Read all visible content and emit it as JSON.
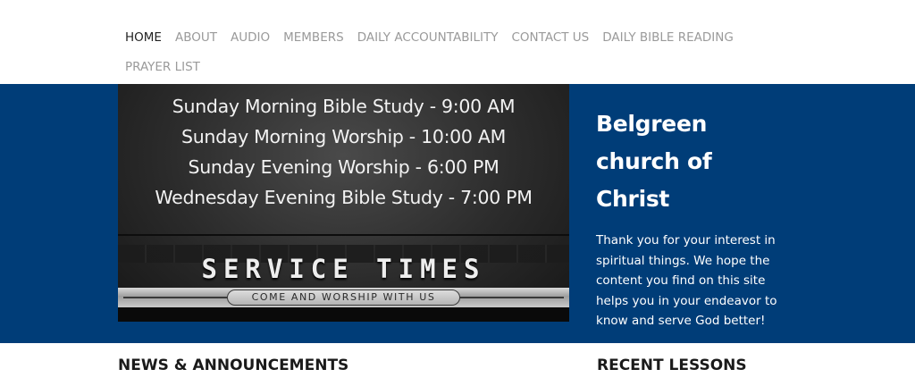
{
  "nav": {
    "items": [
      "HOME",
      "ABOUT",
      "AUDIO",
      "MEMBERS",
      "DAILY ACCOUNTABILITY",
      "CONTACT US",
      "DAILY BIBLE READING",
      "PRAYER LIST"
    ],
    "active": "HOME"
  },
  "banner": {
    "schedule": [
      "Sunday Morning Bible Study -  9:00 AM",
      "Sunday Morning Worship -  10:00 AM",
      "Sunday Evening Worship - 6:00 PM",
      "Wednesday Evening Bible Study - 7:00 PM"
    ],
    "headline": "SERVICE TIMES",
    "tagline": "COME AND WORSHIP WITH US"
  },
  "hero": {
    "title_lines": [
      "Belgreen",
      "church of",
      "Christ"
    ],
    "text": "Thank you for your interest in spiritual things. We hope the content you find on this site helps you in your endeavor to know and serve God better!"
  },
  "sections": {
    "news": "NEWS & ANNOUNCEMENTS",
    "lessons": "RECENT LESSONS"
  },
  "colors": {
    "hero_background": "#003d78",
    "nav_text": "#9a9a9a",
    "nav_active": "#222222"
  }
}
